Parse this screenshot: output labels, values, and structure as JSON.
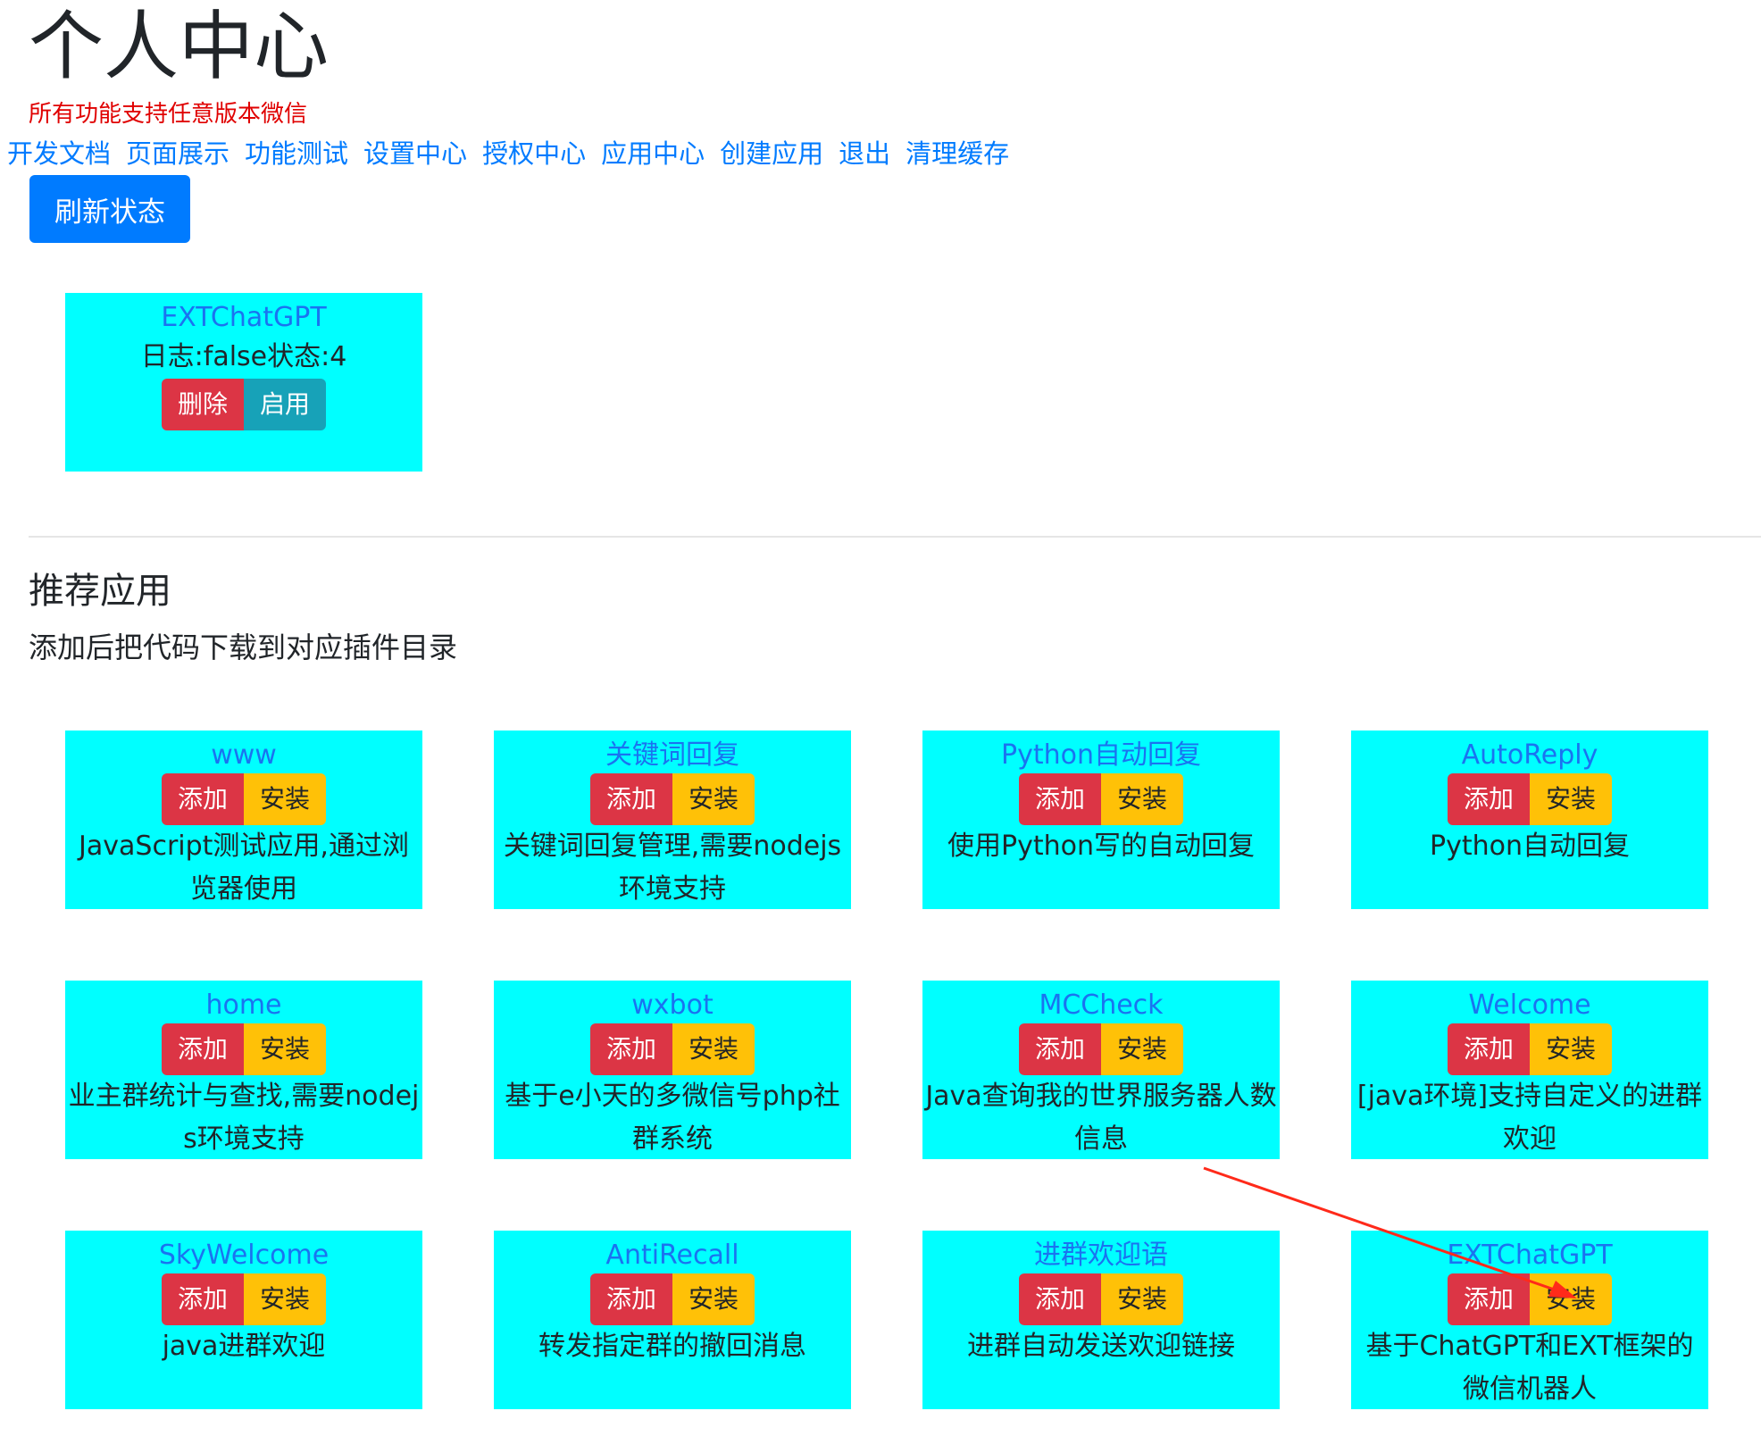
{
  "page": {
    "title": "个人中心",
    "notice": "所有功能支持任意版本微信"
  },
  "nav": {
    "items": [
      "开发文档",
      "页面展示",
      "功能测试",
      "设置中心",
      "授权中心",
      "应用中心",
      "创建应用",
      "退出",
      "清理缓存"
    ]
  },
  "refresh_button": "刷新状态",
  "installed": {
    "name": "EXTChatGPT",
    "status": "日志:false状态:4",
    "delete_label": "删除",
    "enable_label": "启用"
  },
  "recommended": {
    "title": "推荐应用",
    "subtitle": "添加后把代码下载到对应插件目录",
    "add_label": "添加",
    "install_label": "安装",
    "apps": [
      {
        "name": "www",
        "desc": "JavaScript测试应用,通过浏览器使用"
      },
      {
        "name": "关键词回复",
        "desc": "关键词回复管理,需要nodejs环境支持"
      },
      {
        "name": "Python自动回复",
        "desc": "使用Python写的自动回复"
      },
      {
        "name": "AutoReply",
        "desc": "Python自动回复"
      },
      {
        "name": "home",
        "desc": "业主群统计与查找,需要nodejs环境支持"
      },
      {
        "name": "wxbot",
        "desc": "基于e小天的多微信号php社群系统"
      },
      {
        "name": "MCCheck",
        "desc": "Java查询我的世界服务器人数信息"
      },
      {
        "name": "Welcome",
        "desc": "[java环境]支持自定义的进群欢迎"
      },
      {
        "name": "SkyWelcome",
        "desc": "java进群欢迎"
      },
      {
        "name": "AntiRecall",
        "desc": "转发指定群的撤回消息"
      },
      {
        "name": "进群欢迎语",
        "desc": "进群自动发送欢迎链接"
      },
      {
        "name": "EXTChatGPT",
        "desc": "基于ChatGPT和EXT框架的微信机器人"
      }
    ]
  },
  "colors": {
    "card_bg": "#00ffff",
    "link": "#007bff",
    "danger": "#dc3545",
    "info": "#17a2b8",
    "warning": "#ffc107",
    "notice": "#e00000",
    "annotation_arrow": "#ff2a1a"
  }
}
